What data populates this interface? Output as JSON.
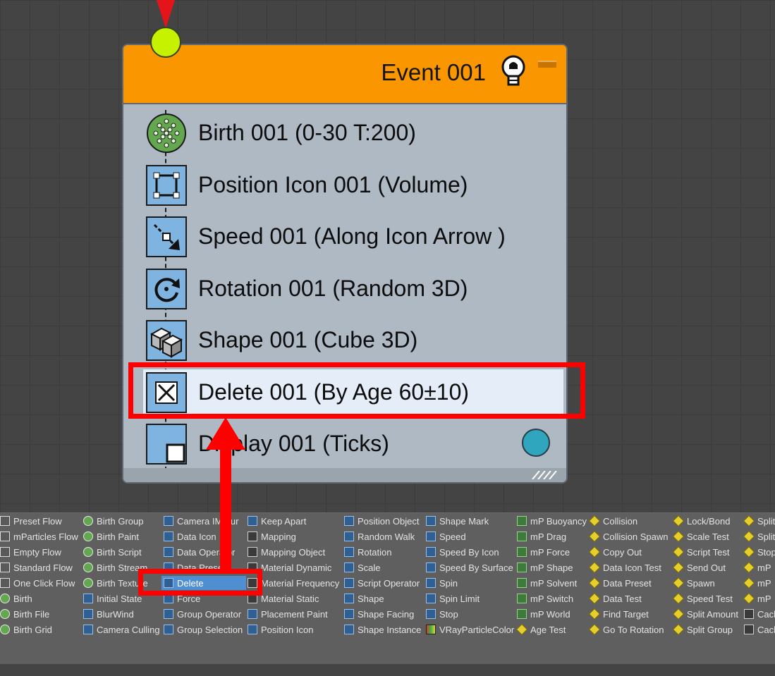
{
  "node": {
    "title": "Event 001",
    "header_color": "#f99600",
    "operators": [
      {
        "label": "Birth 001 (0-30 T:200)",
        "icon": "birth-icon",
        "selected": false
      },
      {
        "label": "Position Icon 001 (Volume)",
        "icon": "position-icon",
        "selected": false
      },
      {
        "label": "Speed 001 (Along Icon Arrow )",
        "icon": "speed-icon",
        "selected": false
      },
      {
        "label": "Rotation 001 (Random 3D)",
        "icon": "rotation-icon",
        "selected": false
      },
      {
        "label": "Shape 001 (Cube 3D)",
        "icon": "shape-icon",
        "selected": false
      },
      {
        "label": "Delete 001 (By Age 60±10)",
        "icon": "delete-icon",
        "selected": true
      },
      {
        "label": "Display 001 (Ticks)",
        "icon": "display-icon",
        "selected": false
      }
    ]
  },
  "depot": {
    "columns": [
      {
        "items": [
          {
            "label": "Preset Flow",
            "icon": "flow"
          },
          {
            "label": "mParticles Flow",
            "icon": "flow"
          },
          {
            "label": "Empty Flow",
            "icon": "flow"
          },
          {
            "label": "Standard Flow",
            "icon": "flow"
          },
          {
            "label": "One Click Flow",
            "icon": "flow"
          },
          {
            "label": "Birth",
            "icon": "birth"
          },
          {
            "label": "Birth File",
            "icon": "birth"
          },
          {
            "label": "Birth Grid",
            "icon": "birth"
          }
        ]
      },
      {
        "items": [
          {
            "label": "Birth Group",
            "icon": "birth"
          },
          {
            "label": "Birth Paint",
            "icon": "birth"
          },
          {
            "label": "Birth Script",
            "icon": "birth"
          },
          {
            "label": "Birth Stream",
            "icon": "birth"
          },
          {
            "label": "Birth Texture",
            "icon": "birth"
          },
          {
            "label": "Initial State",
            "icon": "op"
          },
          {
            "label": "BlurWind",
            "icon": "op"
          },
          {
            "label": "Camera Culling",
            "icon": "op"
          }
        ]
      },
      {
        "items": [
          {
            "label": "Camera IMBlur",
            "icon": "op"
          },
          {
            "label": "Data Icon",
            "icon": "op"
          },
          {
            "label": "Data Operator",
            "icon": "op"
          },
          {
            "label": "Data Preset",
            "icon": "op"
          },
          {
            "label": "Delete",
            "icon": "op",
            "highlight": true
          },
          {
            "label": "Force",
            "icon": "op"
          },
          {
            "label": "Group Operator",
            "icon": "op"
          },
          {
            "label": "Group Selection",
            "icon": "op"
          }
        ]
      },
      {
        "items": [
          {
            "label": "Keep Apart",
            "icon": "op"
          },
          {
            "label": "Mapping",
            "icon": "gray"
          },
          {
            "label": "Mapping Object",
            "icon": "gray"
          },
          {
            "label": "Material Dynamic",
            "icon": "gray"
          },
          {
            "label": "Material Frequency",
            "icon": "gray"
          },
          {
            "label": "Material Static",
            "icon": "gray"
          },
          {
            "label": "Placement Paint",
            "icon": "op"
          },
          {
            "label": "Position Icon",
            "icon": "op"
          }
        ]
      },
      {
        "items": [
          {
            "label": "Position Object",
            "icon": "op"
          },
          {
            "label": "Random Walk",
            "icon": "op"
          },
          {
            "label": "Rotation",
            "icon": "op"
          },
          {
            "label": "Scale",
            "icon": "op"
          },
          {
            "label": "Script Operator",
            "icon": "op"
          },
          {
            "label": "Shape",
            "icon": "op"
          },
          {
            "label": "Shape Facing",
            "icon": "op"
          },
          {
            "label": "Shape Instance",
            "icon": "op"
          }
        ]
      },
      {
        "items": [
          {
            "label": "Shape Mark",
            "icon": "op"
          },
          {
            "label": "Speed",
            "icon": "op"
          },
          {
            "label": "Speed By Icon",
            "icon": "op"
          },
          {
            "label": "Speed By Surface",
            "icon": "op"
          },
          {
            "label": "Spin",
            "icon": "op"
          },
          {
            "label": "Spin Limit",
            "icon": "op"
          },
          {
            "label": "Stop",
            "icon": "op"
          },
          {
            "label": "VRayParticleColor",
            "icon": "color"
          }
        ]
      },
      {
        "items": [
          {
            "label": "mP Buoyancy",
            "icon": "mp"
          },
          {
            "label": "mP Drag",
            "icon": "mp"
          },
          {
            "label": "mP Force",
            "icon": "mp"
          },
          {
            "label": "mP Shape",
            "icon": "mp"
          },
          {
            "label": "mP Solvent",
            "icon": "mp"
          },
          {
            "label": "mP Switch",
            "icon": "mp"
          },
          {
            "label": "mP World",
            "icon": "mp"
          },
          {
            "label": "Age Test",
            "icon": "test"
          }
        ]
      },
      {
        "items": [
          {
            "label": "Collision",
            "icon": "test"
          },
          {
            "label": "Collision Spawn",
            "icon": "test"
          },
          {
            "label": "Copy Out",
            "icon": "test"
          },
          {
            "label": "Data Icon Test",
            "icon": "test"
          },
          {
            "label": "Data Preset",
            "icon": "test"
          },
          {
            "label": "Data Test",
            "icon": "test"
          },
          {
            "label": "Find Target",
            "icon": "test"
          },
          {
            "label": "Go To Rotation",
            "icon": "test"
          }
        ]
      },
      {
        "items": [
          {
            "label": "Lock/Bond",
            "icon": "test"
          },
          {
            "label": "Scale Test",
            "icon": "test"
          },
          {
            "label": "Script Test",
            "icon": "test"
          },
          {
            "label": "Send Out",
            "icon": "test"
          },
          {
            "label": "Spawn",
            "icon": "test"
          },
          {
            "label": "Speed Test",
            "icon": "test"
          },
          {
            "label": "Split Amount",
            "icon": "test"
          },
          {
            "label": "Split Group",
            "icon": "test"
          }
        ]
      },
      {
        "items": [
          {
            "label": "Split",
            "icon": "test"
          },
          {
            "label": "Split",
            "icon": "test"
          },
          {
            "label": "Stop",
            "icon": "test"
          },
          {
            "label": "mP",
            "icon": "test"
          },
          {
            "label": "mP",
            "icon": "test"
          },
          {
            "label": "mP",
            "icon": "test"
          },
          {
            "label": "Cach",
            "icon": "gray"
          },
          {
            "label": "Cach",
            "icon": "gray"
          }
        ]
      }
    ]
  },
  "colors": {
    "canvas": "#444444",
    "node_body": "#aeb9c4",
    "annotation": "#ff0000",
    "input_socket": "#c6f200",
    "output_socket": "#2fa6bd"
  }
}
